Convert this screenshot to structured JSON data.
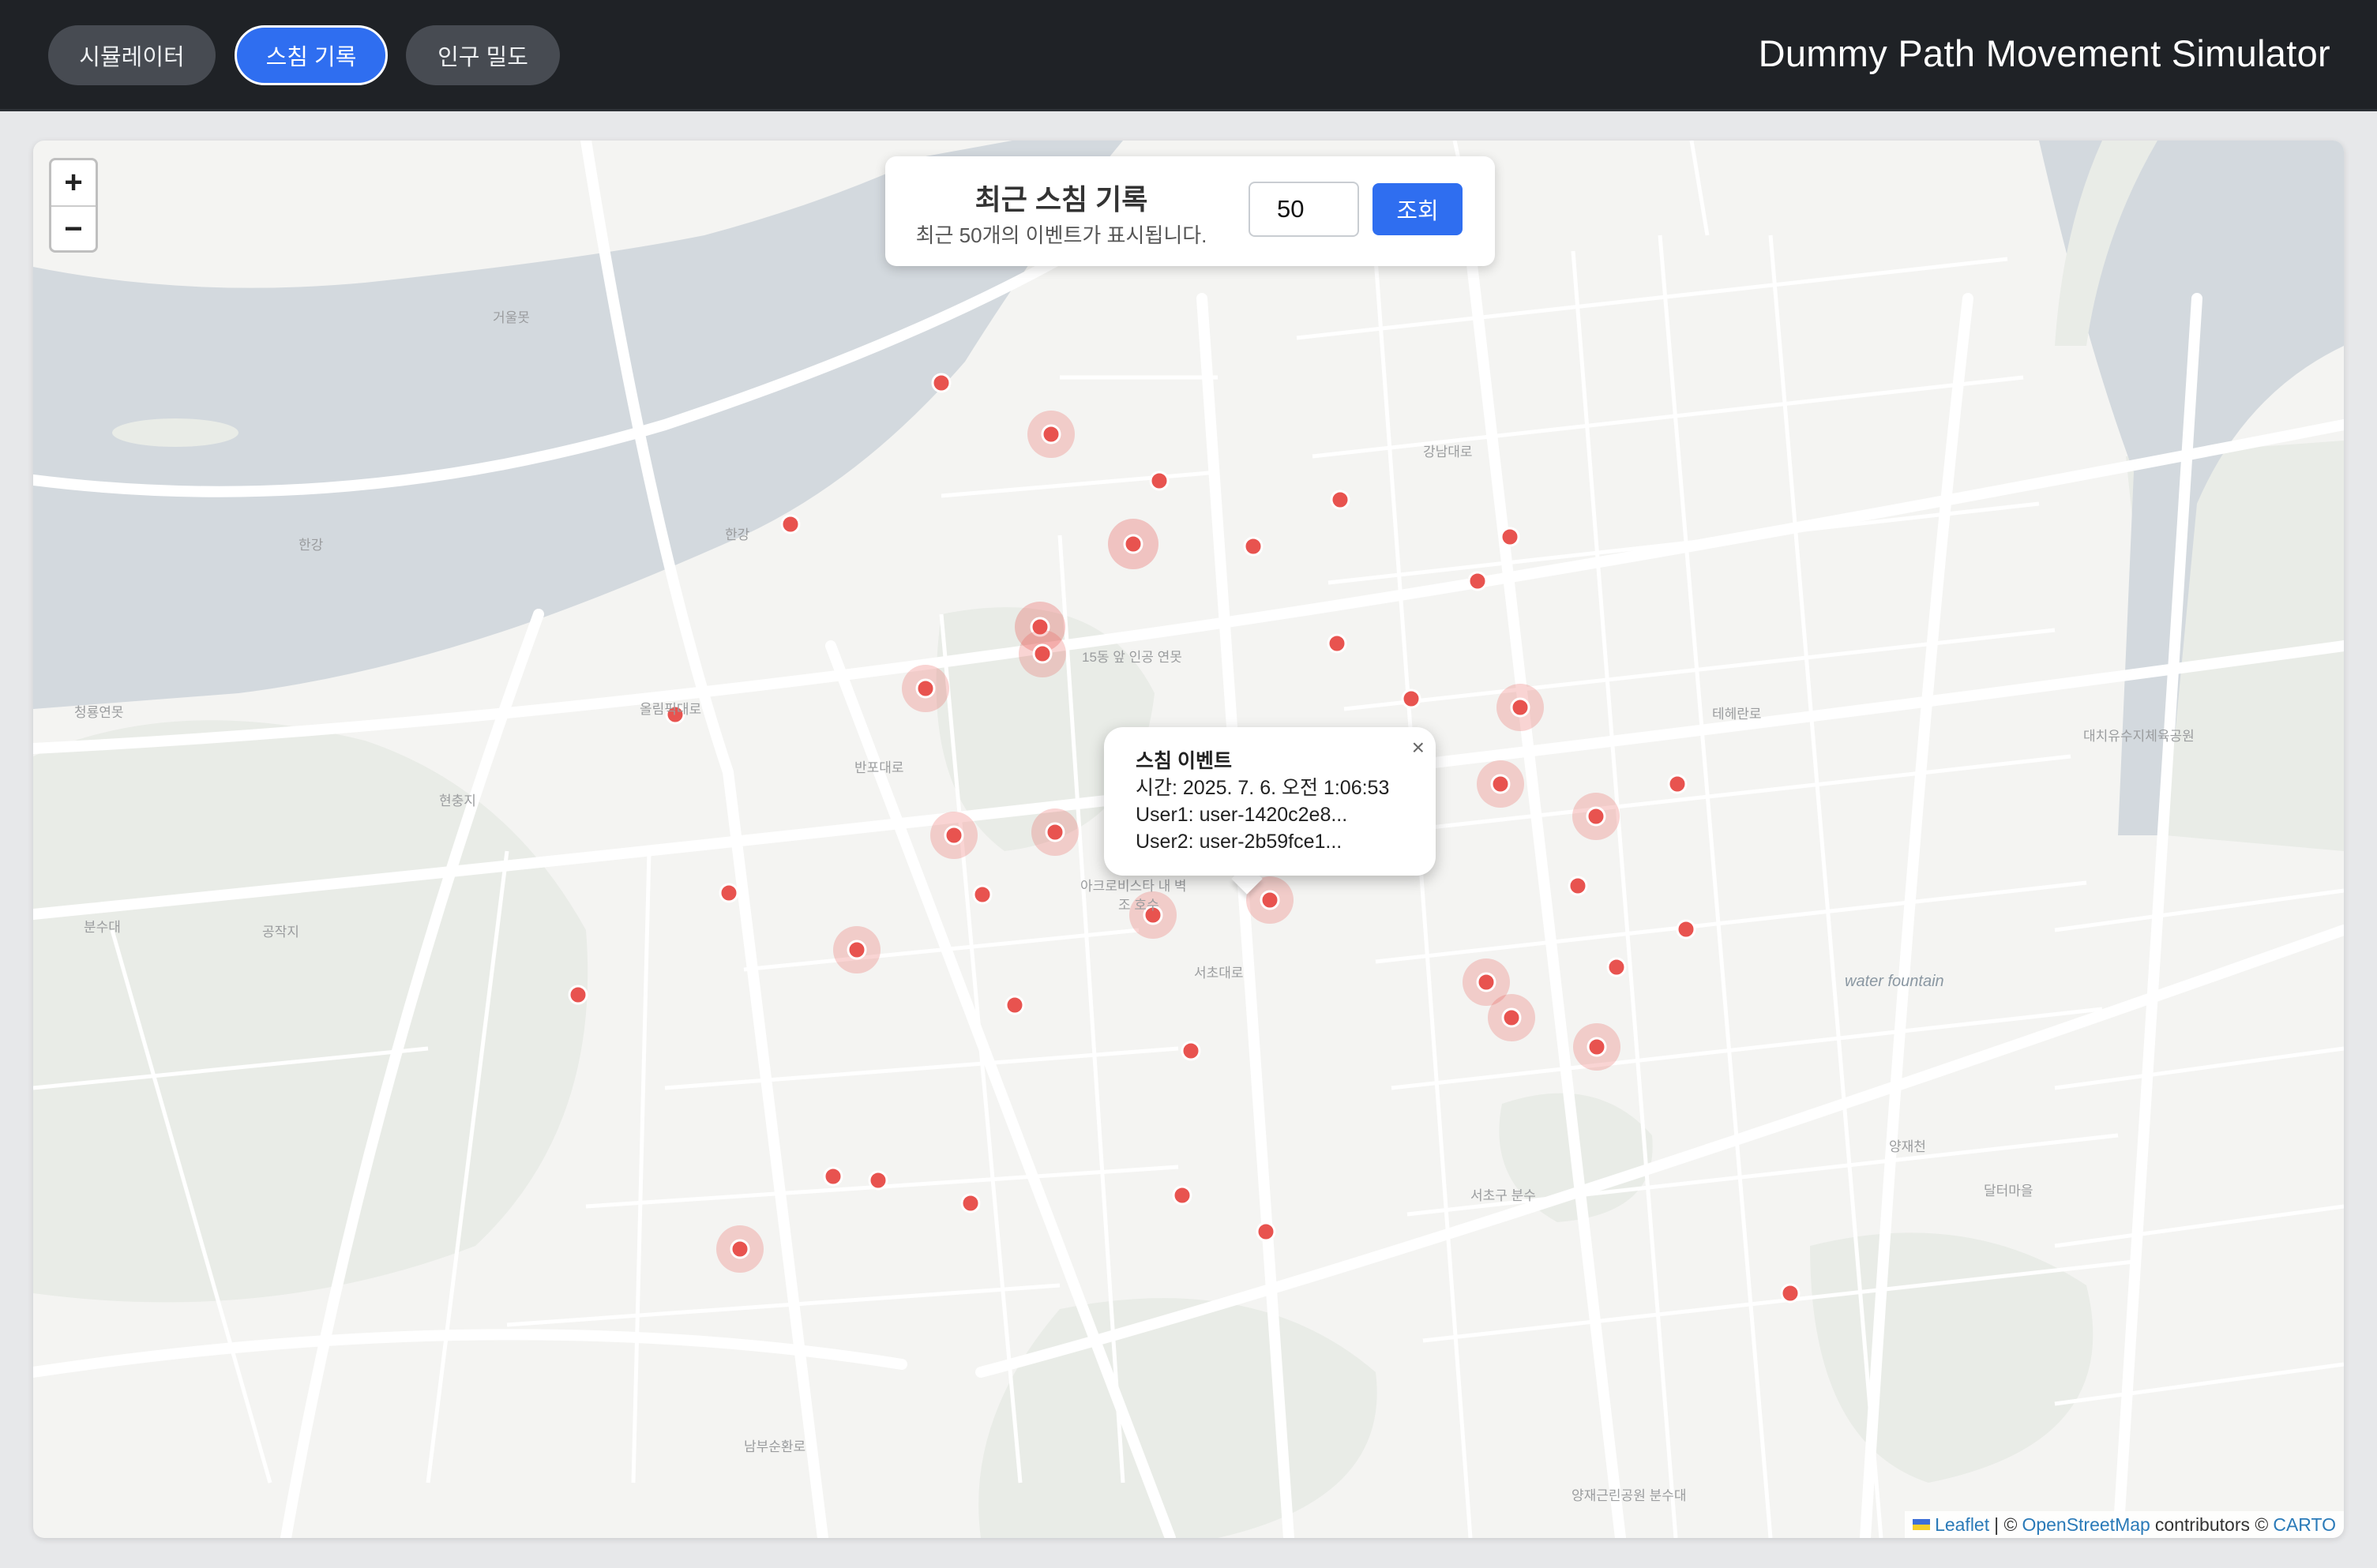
{
  "header": {
    "tabs": [
      {
        "label": "시뮬레이터",
        "active": false
      },
      {
        "label": "스침 기록",
        "active": true
      },
      {
        "label": "인구 밀도",
        "active": false
      }
    ],
    "app_title": "Dummy Path Movement Simulator"
  },
  "map": {
    "zoom_in": "+",
    "zoom_out": "−",
    "labels": [
      "거울못",
      "한강",
      "한강",
      "청룡연못",
      "현충지",
      "공작지",
      "분수대",
      "15동 앞 인공 연못",
      "아크로비스타 내 벽",
      "조 호수",
      "water fountain",
      "대치유수지체육공원",
      "달터마을",
      "서초구 분수",
      "양재근린공원 분수대",
      "올림픽대로",
      "반포대로",
      "서초대로",
      "남부순환로",
      "테헤란로",
      "강남대로",
      "양재천"
    ],
    "marker_color": "#e8534f",
    "attribution": {
      "leaflet": "Leaflet",
      "osm": "OpenStreetMap",
      "text": "contributors ©",
      "carto": "CARTO",
      "prefix": "| ©"
    }
  },
  "swim_panel": {
    "title": "최근 스침 기록",
    "subtitle": "최근 50개의 이벤트가 표시됩니다.",
    "count_value": "50",
    "query_button": "조회"
  },
  "popup": {
    "title": "스침 이벤트",
    "time": "시간: 2025. 7. 6. 오전 1:06:53",
    "user1": "User1: user-1420c2e8...",
    "user2": "User2: user-2b59fce1...",
    "close": "×"
  }
}
